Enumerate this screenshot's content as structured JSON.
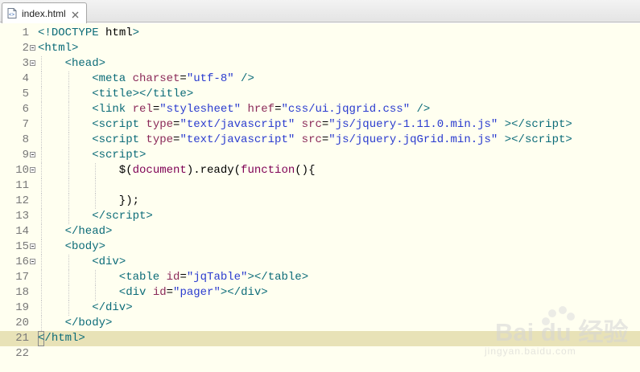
{
  "tab": {
    "title": "index.html"
  },
  "editor": {
    "current_line": 21,
    "lines": [
      {
        "num": "1",
        "fold": false,
        "indent": 0,
        "tokens": [
          [
            "br",
            "<!"
          ],
          [
            "tag",
            "DOCTYPE"
          ],
          [
            "plain",
            " html"
          ],
          [
            "br",
            ">"
          ]
        ]
      },
      {
        "num": "2",
        "fold": true,
        "indent": 0,
        "tokens": [
          [
            "br",
            "<"
          ],
          [
            "tag",
            "html"
          ],
          [
            "br",
            ">"
          ]
        ]
      },
      {
        "num": "3",
        "fold": true,
        "indent": 1,
        "tokens": [
          [
            "br",
            "<"
          ],
          [
            "tag",
            "head"
          ],
          [
            "br",
            ">"
          ]
        ]
      },
      {
        "num": "4",
        "fold": false,
        "indent": 2,
        "tokens": [
          [
            "br",
            "<"
          ],
          [
            "tag",
            "meta"
          ],
          [
            "plain",
            " "
          ],
          [
            "attr",
            "charset"
          ],
          [
            "plain",
            "="
          ],
          [
            "val",
            "\"utf-8\""
          ],
          [
            "plain",
            " "
          ],
          [
            "br",
            "/>"
          ]
        ]
      },
      {
        "num": "5",
        "fold": false,
        "indent": 2,
        "tokens": [
          [
            "br",
            "<"
          ],
          [
            "tag",
            "title"
          ],
          [
            "br",
            "></"
          ],
          [
            "tag",
            "title"
          ],
          [
            "br",
            ">"
          ]
        ]
      },
      {
        "num": "6",
        "fold": false,
        "indent": 2,
        "tokens": [
          [
            "br",
            "<"
          ],
          [
            "tag",
            "link"
          ],
          [
            "plain",
            " "
          ],
          [
            "attr",
            "rel"
          ],
          [
            "plain",
            "="
          ],
          [
            "val",
            "\"stylesheet\""
          ],
          [
            "plain",
            " "
          ],
          [
            "attr",
            "href"
          ],
          [
            "plain",
            "="
          ],
          [
            "val",
            "\"css/ui.jqgrid.css\""
          ],
          [
            "plain",
            " "
          ],
          [
            "br",
            "/>"
          ]
        ]
      },
      {
        "num": "7",
        "fold": false,
        "indent": 2,
        "tokens": [
          [
            "br",
            "<"
          ],
          [
            "tag",
            "script"
          ],
          [
            "plain",
            " "
          ],
          [
            "attr",
            "type"
          ],
          [
            "plain",
            "="
          ],
          [
            "val",
            "\"text/javascript\""
          ],
          [
            "plain",
            " "
          ],
          [
            "attr",
            "src"
          ],
          [
            "plain",
            "="
          ],
          [
            "val",
            "\"js/jquery-1.11.0.min.js\""
          ],
          [
            "plain",
            " "
          ],
          [
            "br",
            "></"
          ],
          [
            "tag",
            "script"
          ],
          [
            "br",
            ">"
          ]
        ]
      },
      {
        "num": "8",
        "fold": false,
        "indent": 2,
        "tokens": [
          [
            "br",
            "<"
          ],
          [
            "tag",
            "script"
          ],
          [
            "plain",
            " "
          ],
          [
            "attr",
            "type"
          ],
          [
            "plain",
            "="
          ],
          [
            "val",
            "\"text/javascript\""
          ],
          [
            "plain",
            " "
          ],
          [
            "attr",
            "src"
          ],
          [
            "plain",
            "="
          ],
          [
            "val",
            "\"js/jquery.jqGrid.min.js\""
          ],
          [
            "plain",
            " "
          ],
          [
            "br",
            "></"
          ],
          [
            "tag",
            "script"
          ],
          [
            "br",
            ">"
          ]
        ]
      },
      {
        "num": "9",
        "fold": true,
        "indent": 2,
        "tokens": [
          [
            "br",
            "<"
          ],
          [
            "tag",
            "script"
          ],
          [
            "br",
            ">"
          ]
        ]
      },
      {
        "num": "10",
        "fold": true,
        "indent": 3,
        "tokens": [
          [
            "plain",
            "$("
          ],
          [
            "js",
            "document"
          ],
          [
            "plain",
            ").ready("
          ],
          [
            "js",
            "function"
          ],
          [
            "plain",
            "(){"
          ]
        ]
      },
      {
        "num": "11",
        "fold": false,
        "indent": 3,
        "tokens": []
      },
      {
        "num": "12",
        "fold": false,
        "indent": 3,
        "tokens": [
          [
            "plain",
            "});"
          ]
        ]
      },
      {
        "num": "13",
        "fold": false,
        "indent": 2,
        "tokens": [
          [
            "br",
            "</"
          ],
          [
            "tag",
            "script"
          ],
          [
            "br",
            ">"
          ]
        ]
      },
      {
        "num": "14",
        "fold": false,
        "indent": 1,
        "tokens": [
          [
            "br",
            "</"
          ],
          [
            "tag",
            "head"
          ],
          [
            "br",
            ">"
          ]
        ]
      },
      {
        "num": "15",
        "fold": true,
        "indent": 1,
        "tokens": [
          [
            "br",
            "<"
          ],
          [
            "tag",
            "body"
          ],
          [
            "br",
            ">"
          ]
        ]
      },
      {
        "num": "16",
        "fold": true,
        "indent": 2,
        "tokens": [
          [
            "br",
            "<"
          ],
          [
            "tag",
            "div"
          ],
          [
            "br",
            ">"
          ]
        ]
      },
      {
        "num": "17",
        "fold": false,
        "indent": 3,
        "tokens": [
          [
            "br",
            "<"
          ],
          [
            "tag",
            "table"
          ],
          [
            "plain",
            " "
          ],
          [
            "attr",
            "id"
          ],
          [
            "plain",
            "="
          ],
          [
            "val",
            "\"jqTable\""
          ],
          [
            "br",
            "></"
          ],
          [
            "tag",
            "table"
          ],
          [
            "br",
            ">"
          ]
        ]
      },
      {
        "num": "18",
        "fold": false,
        "indent": 3,
        "tokens": [
          [
            "br",
            "<"
          ],
          [
            "tag",
            "div"
          ],
          [
            "plain",
            " "
          ],
          [
            "attr",
            "id"
          ],
          [
            "plain",
            "="
          ],
          [
            "val",
            "\"pager\""
          ],
          [
            "br",
            "></"
          ],
          [
            "tag",
            "div"
          ],
          [
            "br",
            ">"
          ]
        ]
      },
      {
        "num": "19",
        "fold": false,
        "indent": 2,
        "tokens": [
          [
            "br",
            "</"
          ],
          [
            "tag",
            "div"
          ],
          [
            "br",
            ">"
          ]
        ]
      },
      {
        "num": "20",
        "fold": false,
        "indent": 1,
        "tokens": [
          [
            "br",
            "</"
          ],
          [
            "tag",
            "body"
          ],
          [
            "br",
            ">"
          ]
        ]
      },
      {
        "num": "21",
        "fold": false,
        "indent": 0,
        "tokens": [
          [
            "br",
            "</"
          ],
          [
            "tag",
            "html"
          ],
          [
            "br",
            ">"
          ]
        ]
      },
      {
        "num": "22",
        "fold": false,
        "indent": 0,
        "tokens": []
      }
    ]
  },
  "watermark": {
    "text": "Bai du 经验",
    "sub": "jingyan.baidu.com"
  },
  "colors": {
    "tag": "#0b6b78",
    "attr": "#8b2a59",
    "value": "#2a3bcf",
    "keyword": "#7f0055",
    "editor_bg": "#fffff0",
    "current_line_bg": "#e8e2b7",
    "line_number": "#787878"
  },
  "icons": {
    "file": "html-file-icon",
    "close": "close-icon",
    "fold": "fold-minus-icon"
  }
}
